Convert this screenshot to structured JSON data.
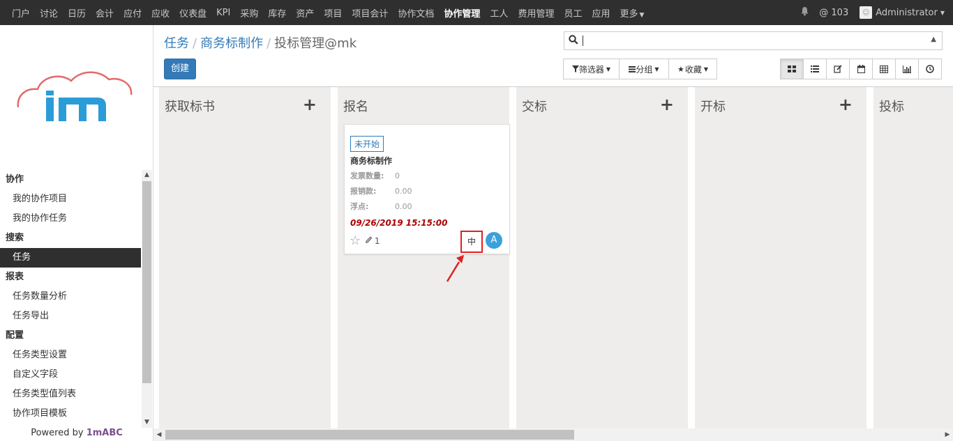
{
  "topbar": {
    "menu": [
      "门户",
      "讨论",
      "日历",
      "会计",
      "应付",
      "应收",
      "仪表盘",
      "KPI",
      "采购",
      "库存",
      "资产",
      "项目",
      "项目会计",
      "协作文档",
      "协作管理",
      "工人",
      "费用管理",
      "员工",
      "应用",
      "更多"
    ],
    "active": "协作管理",
    "mentions": "@ 103",
    "user": "Administrator"
  },
  "sidebar": {
    "sections": [
      {
        "head": "协作",
        "items": [
          "我的协作项目",
          "我的协作任务"
        ]
      },
      {
        "head": "搜索",
        "items": [
          "任务"
        ]
      },
      {
        "head": "报表",
        "items": [
          "任务数量分析",
          "任务导出"
        ]
      },
      {
        "head": "配置",
        "items": [
          "任务类型设置",
          "自定义字段",
          "任务类型值列表",
          "协作项目模板"
        ]
      }
    ],
    "powered_prefix": "Powered by",
    "powered_brand": "1mABC"
  },
  "breadcrumb": {
    "b1": "任务",
    "b2": "商务标制作",
    "current": "投标管理@mk"
  },
  "create_label": "创建",
  "filters": {
    "filter": "筛选器",
    "group": "分组",
    "fav": "收藏"
  },
  "columns": [
    "获取标书",
    "报名",
    "交标",
    "开标",
    "投标"
  ],
  "card": {
    "status": "未开始",
    "name": "商务标制作",
    "f1_label": "发票数量:",
    "f1_value": "0",
    "f2_label": "报销款:",
    "f2_value": "0.00",
    "f3_label": "浮点:",
    "f3_value": "0.00",
    "date": "09/26/2019 15:15:00",
    "attachments": "1",
    "priority": "中",
    "avatar": "A"
  },
  "colors": {
    "primary": "#337ab7",
    "topbar": "#2f2f2f",
    "highlight": "#e02020",
    "avatar": "#3ba1da"
  }
}
